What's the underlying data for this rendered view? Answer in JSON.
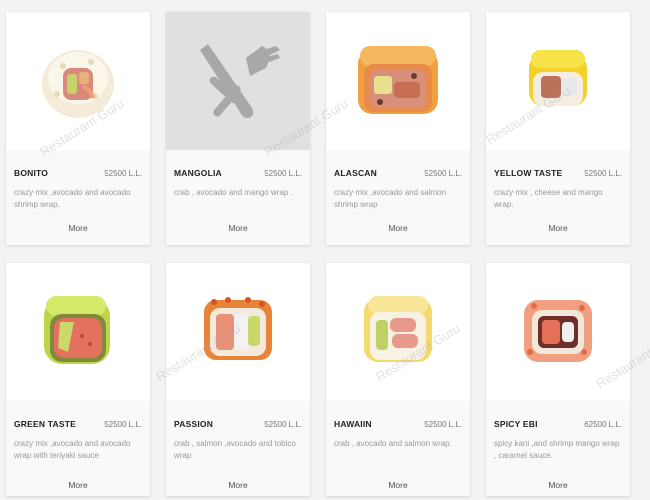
{
  "watermark_text": "Restaurant Guru",
  "items": [
    {
      "name": "BONITO",
      "price": "52500 L.L.",
      "description": "crazy mix ,avocado and avocado shrimp wrap.",
      "more_label": "More",
      "image": "sushi-roll-bonito",
      "placeholder": false
    },
    {
      "name": "MANGOLIA",
      "price": "52500 L.L.",
      "description": "crab , avocado and mango wrap .",
      "more_label": "More",
      "image": "fork-knife-icon",
      "placeholder": true
    },
    {
      "name": "ALASCAN",
      "price": "52500 L.L.",
      "description": "crazy mix ,avocado and salmon shrimp wrap",
      "more_label": "More",
      "image": "sushi-roll-alascan",
      "placeholder": false
    },
    {
      "name": "YELLOW TASTE",
      "price": "52500 L.L.",
      "description": "crazy mix , cheese and mango wrap.",
      "more_label": "More",
      "image": "sushi-roll-yellow-taste",
      "placeholder": false
    },
    {
      "name": "GREEN TASTE",
      "price": "52500 L.L.",
      "description": "crazy mix ,avocado and avocado wrap with teriyaki sauce",
      "more_label": "More",
      "image": "sushi-roll-green-taste",
      "placeholder": false
    },
    {
      "name": "PASSION",
      "price": "52500 L.L.",
      "description": "crab , salmon ,avocado and tobico wrap",
      "more_label": "More",
      "image": "sushi-roll-passion",
      "placeholder": false
    },
    {
      "name": "HAWAIIN",
      "price": "52500 L.L.",
      "description": "crab , avocado and salmon wrap.",
      "more_label": "More",
      "image": "sushi-roll-hawaiin",
      "placeholder": false
    },
    {
      "name": "SPICY EBI",
      "price": "62500 L.L.",
      "description": "spicy kani ,and shrimp mango wrap , caramel sauce.",
      "more_label": "More",
      "image": "sushi-roll-spicy-ebi",
      "placeholder": false
    }
  ]
}
